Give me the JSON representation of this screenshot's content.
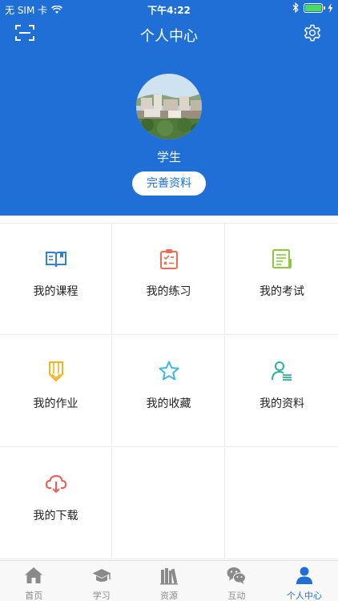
{
  "status_bar": {
    "carrier": "无 SIM 卡",
    "time": "下午4:22"
  },
  "header": {
    "title": "个人中心",
    "scan_icon": "scan-icon",
    "settings_icon": "gear-icon",
    "background_color": "#1f6fd6"
  },
  "profile": {
    "name": "学生",
    "edit_button": "完善资料"
  },
  "menu": [
    {
      "label": "我的课程",
      "icon": "book-icon",
      "color": "#2f80d9"
    },
    {
      "label": "我的练习",
      "icon": "clipboard-icon",
      "color": "#ef6a4f"
    },
    {
      "label": "我的考试",
      "icon": "exam-icon",
      "color": "#8dc63f"
    },
    {
      "label": "我的作业",
      "icon": "pencil-icon",
      "color": "#f5b31b"
    },
    {
      "label": "我的收藏",
      "icon": "star-icon",
      "color": "#3fb6e8"
    },
    {
      "label": "我的资料",
      "icon": "user-list-icon",
      "color": "#2ab29a"
    },
    {
      "label": "我的下载",
      "icon": "cloud-download-icon",
      "color": "#ef5a5a"
    }
  ],
  "tabbar": {
    "items": [
      {
        "label": "首页",
        "icon": "home-icon"
      },
      {
        "label": "学习",
        "icon": "graduation-cap-icon"
      },
      {
        "label": "资源",
        "icon": "books-icon"
      },
      {
        "label": "互动",
        "icon": "chat-icon"
      },
      {
        "label": "个人中心",
        "icon": "person-icon"
      }
    ],
    "active_index": 4,
    "active_color": "#1f6fd6",
    "inactive_color": "#8a8a8a"
  }
}
